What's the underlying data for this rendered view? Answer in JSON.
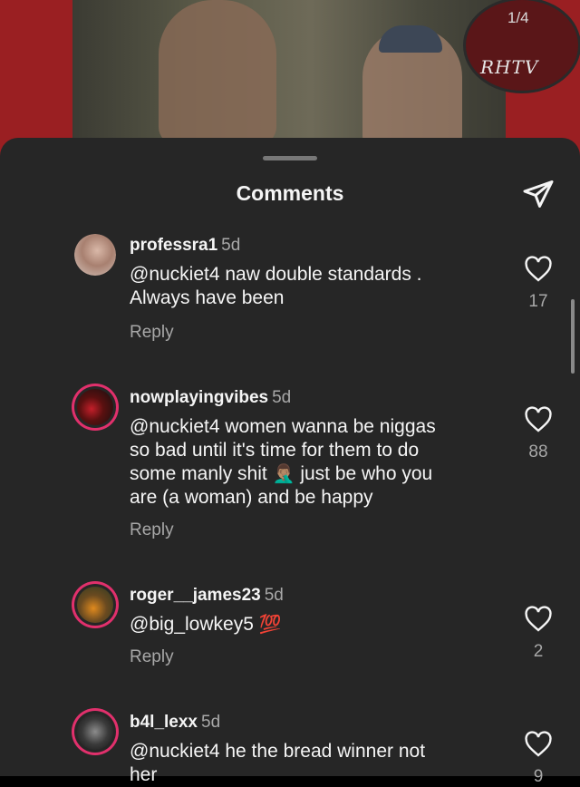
{
  "header": {
    "counter": "1/4",
    "brand": "RHTV"
  },
  "sheet": {
    "title": "Comments"
  },
  "comments": [
    {
      "username": "professra1",
      "time": "5d",
      "lines": [
        "@nuckiet4 naw double standards .",
        "Always have been"
      ],
      "reply": "Reply",
      "likes": "17"
    },
    {
      "username": "nowplayingvibes",
      "time": "5d",
      "lines": [
        "@nuckiet4 women wanna be niggas",
        "so bad until it's time for them to do",
        "some manly shit",
        "just be who you",
        "are (a woman) and be happy"
      ],
      "emoji": "🤦🏽‍♂️",
      "reply": "Reply",
      "likes": "88"
    },
    {
      "username": "roger__james23",
      "time": "5d",
      "lines": [
        "@big_lowkey5"
      ],
      "emoji": "💯",
      "reply": "Reply",
      "likes": "2"
    },
    {
      "username": "b4l_lexx",
      "time": "5d",
      "lines": [
        "@nuckiet4 he the bread winner not",
        "her"
      ],
      "likes": "9"
    }
  ],
  "colors": {
    "sheet_bg": "#262626",
    "text": "#f5f5f5",
    "muted": "#a8a8a8",
    "story_ring": "#e1306c",
    "backdrop_red": "#9a1f22"
  },
  "icons": {
    "send": "send-icon",
    "like": "heart-icon"
  }
}
